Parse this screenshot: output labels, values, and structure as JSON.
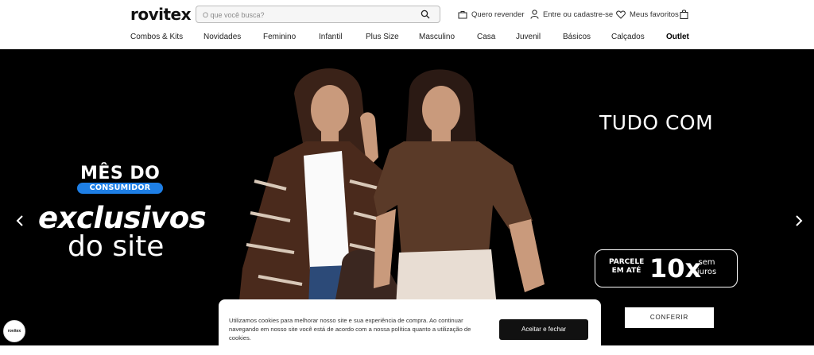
{
  "header": {
    "logo": "rovitex",
    "search": {
      "placeholder": "O que você busca?"
    },
    "resell_label": "Quero revender",
    "login_label": "Entre ou cadastre-se",
    "favorites_label": "Meus favoritos"
  },
  "nav": {
    "items": [
      "Combos & Kits",
      "Novidades",
      "Feminino",
      "Infantil",
      "Plus Size",
      "Masculino",
      "Casa",
      "Juvenil",
      "Básicos",
      "Calçados",
      "Outlet"
    ]
  },
  "hero": {
    "mes_do": "MÊS DO",
    "consumidor": "CONSUMIDOR",
    "exclusivos": "exclusivos",
    "do_site": "do site",
    "tudo_com": "TUDO COM",
    "parcele": "PARCELE EM ATÉ",
    "parcele_big": "10x",
    "parcele_juros": "sem juros",
    "conferir": "CONFERIR"
  },
  "cookie": {
    "text": "Utilizamos cookies para melhorar nosso site e sua experiência de compra. Ao continuar navegando em nosso site você está de acordo com a nossa política quanto a utilização de cookies.",
    "accept_label": "Aceitar e fechar"
  },
  "chat": {
    "label": "rovitex"
  },
  "colors": {
    "badge_blue": "#1e7fe6",
    "hero_bg": "#000000",
    "blouse_brown": "#5a3a28"
  }
}
